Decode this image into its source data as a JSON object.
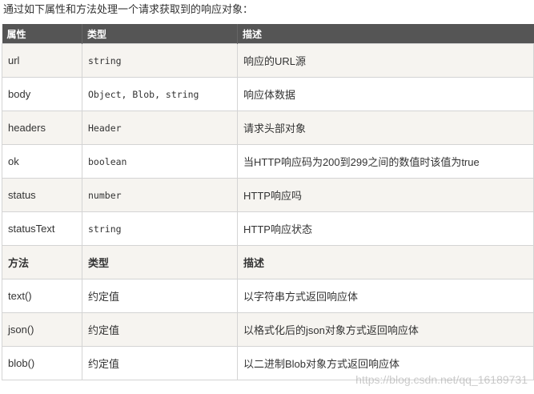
{
  "intro": "通过如下属性和方法处理一个请求获取到的响应对象：",
  "table": {
    "header": {
      "col1": "属性",
      "col2": "类型",
      "col3": "描述"
    },
    "property_rows": [
      {
        "name": "url",
        "type": "string",
        "desc": "响应的URL源"
      },
      {
        "name": "body",
        "type": "Object, Blob, string",
        "desc": "响应体数据"
      },
      {
        "name": "headers",
        "type": "Header",
        "desc": "请求头部对象"
      },
      {
        "name": "ok",
        "type": "boolean",
        "desc": "当HTTP响应码为200到299之间的数值时该值为true"
      },
      {
        "name": "status",
        "type": "number",
        "desc": "HTTP响应吗"
      },
      {
        "name": "statusText",
        "type": "string",
        "desc": "HTTP响应状态"
      }
    ],
    "method_header": {
      "col1": "方法",
      "col2": "类型",
      "col3": "描述"
    },
    "method_rows": [
      {
        "name": "text()",
        "type": "约定值",
        "desc": "以字符串方式返回响应体"
      },
      {
        "name": "json()",
        "type": "约定值",
        "desc": "以格式化后的json对象方式返回响应体"
      },
      {
        "name": "blob()",
        "type": "约定值",
        "desc": "以二进制Blob对象方式返回响应体"
      }
    ]
  },
  "watermark": "https://blog.csdn.net/qq_16189731"
}
